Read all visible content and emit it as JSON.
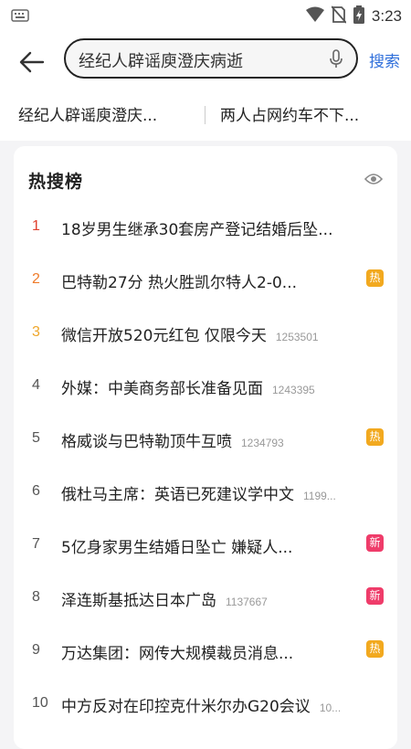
{
  "status_bar": {
    "time": "3:23"
  },
  "search": {
    "query": "经纪人辟谣庾澄庆病逝",
    "button_label": "搜索"
  },
  "suggestions": [
    "经纪人辟谣庾澄庆...",
    "两人占网约车不下..."
  ],
  "hot_list": {
    "title_main": "热搜",
    "title_tail": "榜",
    "items": [
      {
        "rank": "1",
        "title": "18岁男生继承30套房产登记结婚后坠...",
        "count": "",
        "badge": ""
      },
      {
        "rank": "2",
        "title": "巴特勒27分 热火胜凯尔特人2-0...",
        "count": "",
        "badge": "热"
      },
      {
        "rank": "3",
        "title": "微信开放520元红包 仅限今天",
        "count": "1253501",
        "badge": ""
      },
      {
        "rank": "4",
        "title": "外媒：中美商务部长准备见面",
        "count": "1243395",
        "badge": ""
      },
      {
        "rank": "5",
        "title": "格威谈与巴特勒顶牛互喷",
        "count": "1234793",
        "badge": "热"
      },
      {
        "rank": "6",
        "title": "俄杜马主席：英语已死建议学中文",
        "count": "1199...",
        "badge": ""
      },
      {
        "rank": "7",
        "title": "5亿身家男生结婚日坠亡 嫌疑人...",
        "count": "",
        "badge": "新"
      },
      {
        "rank": "8",
        "title": "泽连斯基抵达日本广岛",
        "count": "1137667",
        "badge": "新"
      },
      {
        "rank": "9",
        "title": "万达集团：网传大规模裁员消息...",
        "count": "",
        "badge": "热"
      },
      {
        "rank": "10",
        "title": "中方反对在印控克什米尔办G20会议",
        "count": "10...",
        "badge": ""
      }
    ]
  },
  "colors": {
    "accent_blue": "#2f6fdb",
    "rank1": "#e0412f",
    "rank2": "#ef7b2a",
    "rank3": "#efa62a",
    "badge_hot": "#f2a91f",
    "badge_new": "#ef3c6a"
  }
}
